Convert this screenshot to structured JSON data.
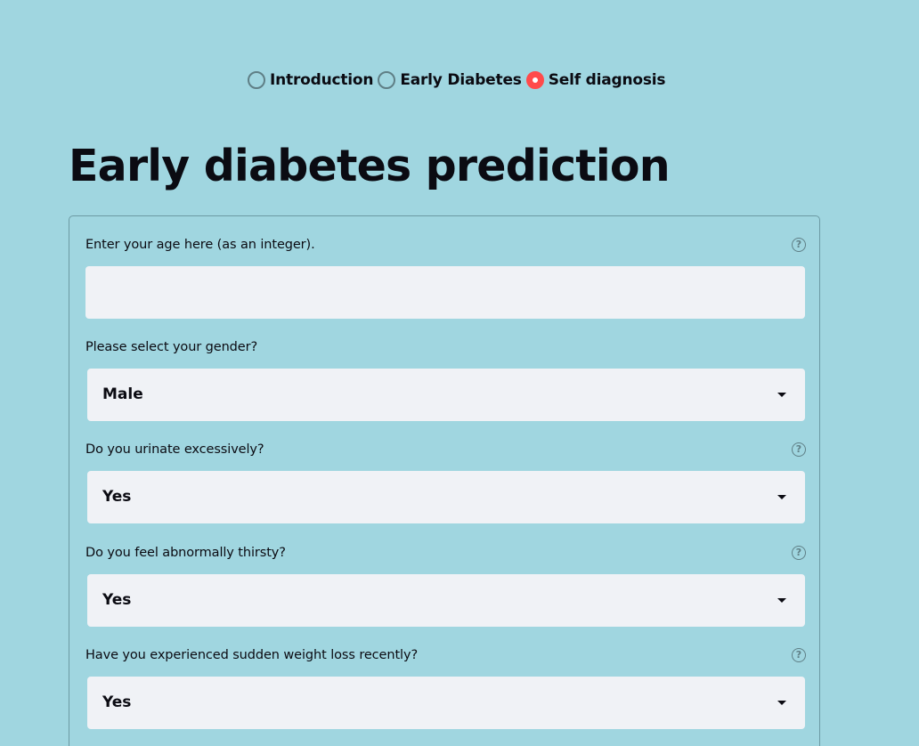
{
  "nav": {
    "options": [
      {
        "label": "Introduction",
        "selected": false
      },
      {
        "label": "Early Diabetes",
        "selected": false
      },
      {
        "label": "Self diagnosis",
        "selected": true
      }
    ],
    "accent_color": "#ff4b4b"
  },
  "page_title": "Early diabetes prediction",
  "form": {
    "age": {
      "label": "Enter your age here (as an integer).",
      "value": "",
      "has_help": true
    },
    "gender": {
      "label": "Please select your gender?",
      "value": "Male"
    },
    "polyuria": {
      "label": "Do you urinate excessively?",
      "value": "Yes",
      "has_help": true
    },
    "polydipsia": {
      "label": "Do you feel abnormally thirsty?",
      "value": "Yes",
      "has_help": true
    },
    "weight_loss": {
      "label": "Have you experienced sudden weight loss recently?",
      "value": "Yes",
      "has_help": true
    },
    "help_icon": "question-circle-icon",
    "dropdown_icon": "caret-down-icon",
    "background_color": "#a0d6e0"
  }
}
